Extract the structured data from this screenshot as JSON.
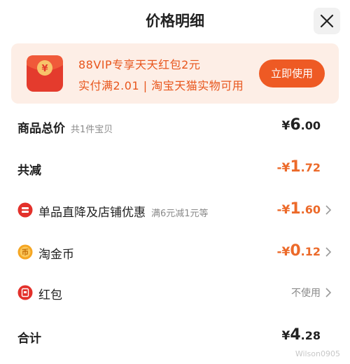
{
  "header": {
    "title": "价格明细"
  },
  "promo": {
    "line1": "88VIP专享天天红包2元",
    "line2": "实付满2.01 | 淘宝天猫实物可用",
    "button": "立即使用",
    "icon": "red-envelope-yuan-icon"
  },
  "rows": {
    "goods_total": {
      "label": "商品总价",
      "sub": "共1件宝贝",
      "currency": "¥",
      "int": "6",
      "cents": ".00"
    },
    "total_reduce": {
      "label": "共减",
      "sign": "-",
      "currency": "¥",
      "int": "1",
      "cents": ".72"
    },
    "discount": {
      "label": "单品直降及店铺优惠",
      "sub": "满6元减1元等",
      "sign": "-",
      "currency": "¥",
      "int": "1",
      "cents": ".60",
      "icon": "discount-badge-icon"
    },
    "coin": {
      "label": "淘金币",
      "sign": "-",
      "currency": "¥",
      "int": "0",
      "cents": ".12",
      "icon": "taojinbi-coin-icon"
    },
    "redpacket": {
      "label": "红包",
      "value": "不使用",
      "icon": "red-packet-icon"
    },
    "sum": {
      "label": "合计",
      "currency": "¥",
      "int": "4",
      "cents": ".28"
    }
  },
  "watermark": "Wilson0905",
  "colors": {
    "accent": "#ee5a24",
    "promo_bg": "#fdeee6",
    "minus": "#ec6a2a"
  }
}
